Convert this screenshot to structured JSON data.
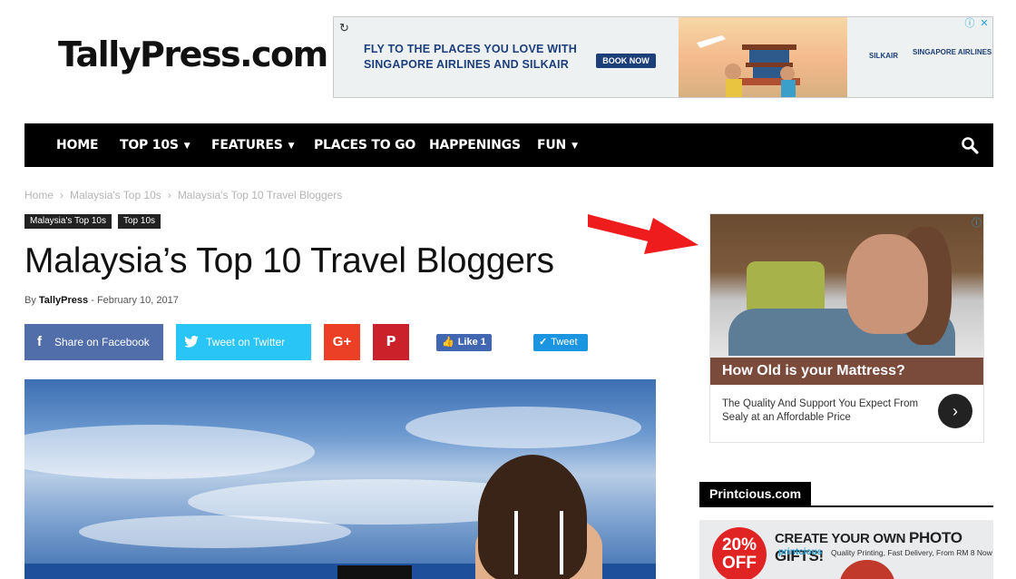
{
  "site": {
    "logo": "TallyPress.com"
  },
  "top_ad": {
    "line1": "FLY TO THE PLACES YOU LOVE WITH",
    "line2": "SINGAPORE AIRLINES AND SILKAIR",
    "cta": "BOOK NOW",
    "brand1": "SILKAIR",
    "brand2": "SINGAPORE AIRLINES"
  },
  "nav": {
    "items": [
      {
        "label": "HOME",
        "has_dropdown": false
      },
      {
        "label": "TOP 10S",
        "has_dropdown": true
      },
      {
        "label": "FEATURES",
        "has_dropdown": true
      },
      {
        "label": "PLACES TO GO",
        "has_dropdown": false
      },
      {
        "label": "HAPPENINGS",
        "has_dropdown": false
      },
      {
        "label": "FUN",
        "has_dropdown": true
      }
    ],
    "search_icon": "search-icon"
  },
  "breadcrumb": [
    "Home",
    "Malaysia's Top 10s",
    "Malaysia's Top 10 Travel Bloggers"
  ],
  "tags": [
    "Malaysia's Top 10s",
    "Top 10s"
  ],
  "article": {
    "title": "Malaysia’s Top 10 Travel Bloggers",
    "by_label": "By",
    "author": "TallyPress",
    "date_sep": "-",
    "date": "February 10, 2017"
  },
  "share": {
    "facebook": "Share on Facebook",
    "twitter": "Tweet on Twitter",
    "like": "Like 1",
    "tweet": "Tweet"
  },
  "sidebar_ad": {
    "headline": "How Old is your Mattress?",
    "subtext": "The Quality And Support You Expect From Sealy at an Affordable Price"
  },
  "widget": {
    "title": "Printcious.com",
    "ad_badge": "20% OFF",
    "ad_headline_prefix": "CREATE YOUR OWN",
    "ad_headline_emph": "PHOTO GIFTS!",
    "ad_brand": "printcious",
    "ad_tagline": "Quality Printing, Fast Delivery, From RM 8 Now"
  },
  "colors": {
    "nav_bg": "#000000",
    "facebook": "#516eab",
    "twitter": "#29c5f6",
    "googleplus": "#eb4026",
    "pinterest": "#ca212a",
    "arrow": "#ee1c1c"
  }
}
